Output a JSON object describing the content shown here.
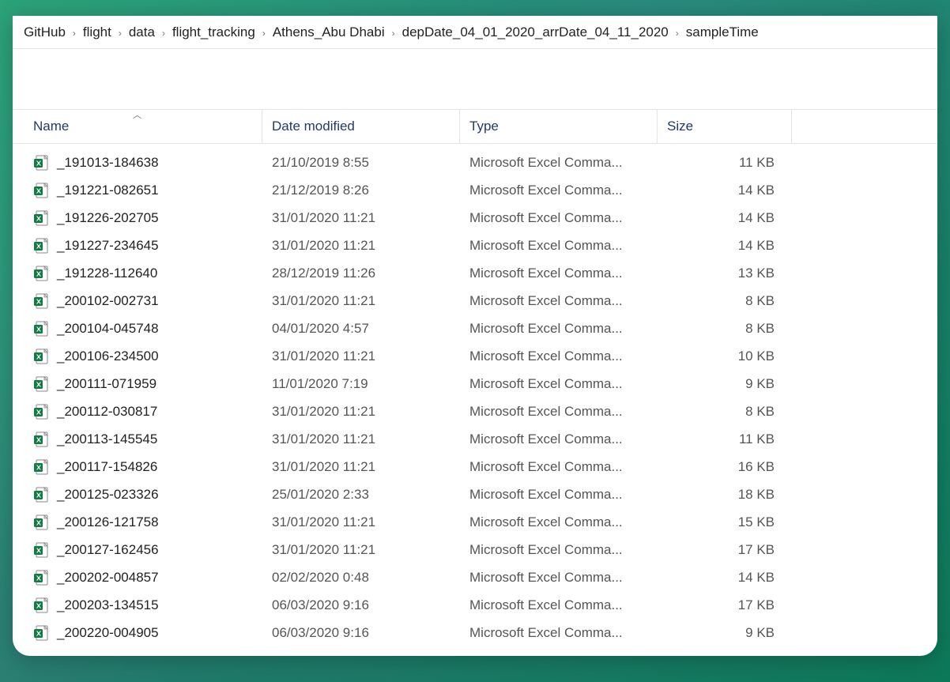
{
  "breadcrumb": {
    "items": [
      {
        "label": "GitHub"
      },
      {
        "label": "flight"
      },
      {
        "label": "data"
      },
      {
        "label": "flight_tracking"
      },
      {
        "label": "Athens_Abu Dhabi"
      },
      {
        "label": "depDate_04_01_2020_arrDate_04_11_2020"
      },
      {
        "label": "sampleTime"
      }
    ],
    "separator": "›"
  },
  "columns": {
    "name": "Name",
    "date": "Date modified",
    "type": "Type",
    "size": "Size"
  },
  "type_label": "Microsoft Excel Comma...",
  "files": [
    {
      "name": "_191013-184638",
      "date": "21/10/2019 8:55",
      "size": "11 KB"
    },
    {
      "name": "_191221-082651",
      "date": "21/12/2019 8:26",
      "size": "14 KB"
    },
    {
      "name": "_191226-202705",
      "date": "31/01/2020 11:21",
      "size": "14 KB"
    },
    {
      "name": "_191227-234645",
      "date": "31/01/2020 11:21",
      "size": "14 KB"
    },
    {
      "name": "_191228-112640",
      "date": "28/12/2019 11:26",
      "size": "13 KB"
    },
    {
      "name": "_200102-002731",
      "date": "31/01/2020 11:21",
      "size": "8 KB"
    },
    {
      "name": "_200104-045748",
      "date": "04/01/2020 4:57",
      "size": "8 KB"
    },
    {
      "name": "_200106-234500",
      "date": "31/01/2020 11:21",
      "size": "10 KB"
    },
    {
      "name": "_200111-071959",
      "date": "11/01/2020 7:19",
      "size": "9 KB"
    },
    {
      "name": "_200112-030817",
      "date": "31/01/2020 11:21",
      "size": "8 KB"
    },
    {
      "name": "_200113-145545",
      "date": "31/01/2020 11:21",
      "size": "11 KB"
    },
    {
      "name": "_200117-154826",
      "date": "31/01/2020 11:21",
      "size": "16 KB"
    },
    {
      "name": "_200125-023326",
      "date": "25/01/2020 2:33",
      "size": "18 KB"
    },
    {
      "name": "_200126-121758",
      "date": "31/01/2020 11:21",
      "size": "15 KB"
    },
    {
      "name": "_200127-162456",
      "date": "31/01/2020 11:21",
      "size": "17 KB"
    },
    {
      "name": "_200202-004857",
      "date": "02/02/2020 0:48",
      "size": "14 KB"
    },
    {
      "name": "_200203-134515",
      "date": "06/03/2020 9:16",
      "size": "17 KB"
    },
    {
      "name": "_200220-004905",
      "date": "06/03/2020 9:16",
      "size": "9 KB"
    }
  ]
}
